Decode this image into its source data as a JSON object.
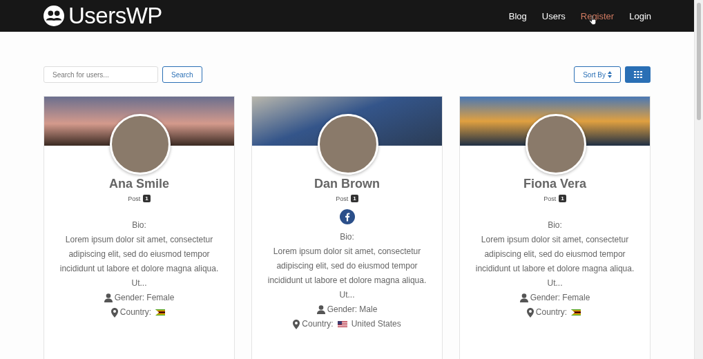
{
  "header": {
    "logo_text": "UsersWP",
    "nav": [
      {
        "label": "Blog",
        "hovered": false
      },
      {
        "label": "Users",
        "hovered": false
      },
      {
        "label": "Register",
        "hovered": true
      },
      {
        "label": "Login",
        "hovered": false
      }
    ]
  },
  "toolbar": {
    "search": {
      "placeholder": "Search for users..."
    },
    "search_button": "Search",
    "sort_button": "Sort By"
  },
  "users": [
    {
      "name": "Ana Smile",
      "post_label": "Post",
      "post_count": "1",
      "bio_label": "Bio:",
      "bio": "Lorem ipsum dolor sit amet, consectetur adipiscing elit, sed do eiusmod tempor incididunt ut labore et dolore magna aliqua. Ut...",
      "gender": "Gender: Female",
      "country_label": "Country:",
      "flag": {
        "kind": "zw"
      }
    },
    {
      "name": "Dan Brown",
      "post_label": "Post",
      "post_count": "1",
      "social_links": [
        {
          "kind": "facebook"
        }
      ],
      "bio_label": "Bio:",
      "bio": "Lorem ipsum dolor sit amet, consectetur adipiscing elit, sed do eiusmod tempor incididunt ut labore et dolore magna aliqua. Ut...",
      "gender": "Gender: Male",
      "country_label": "Country:",
      "flag": {
        "kind": "us"
      },
      "country_name": "United States"
    },
    {
      "name": "Fiona Vera",
      "post_label": "Post",
      "post_count": "1",
      "bio_label": "Bio:",
      "bio": "Lorem ipsum dolor sit amet, consectetur adipiscing elit, sed do eiusmod tempor incididunt ut labore et dolore magna aliqua. Ut...",
      "gender": "Gender: Female",
      "country_label": "Country:",
      "flag": {
        "kind": "zw"
      }
    }
  ]
}
